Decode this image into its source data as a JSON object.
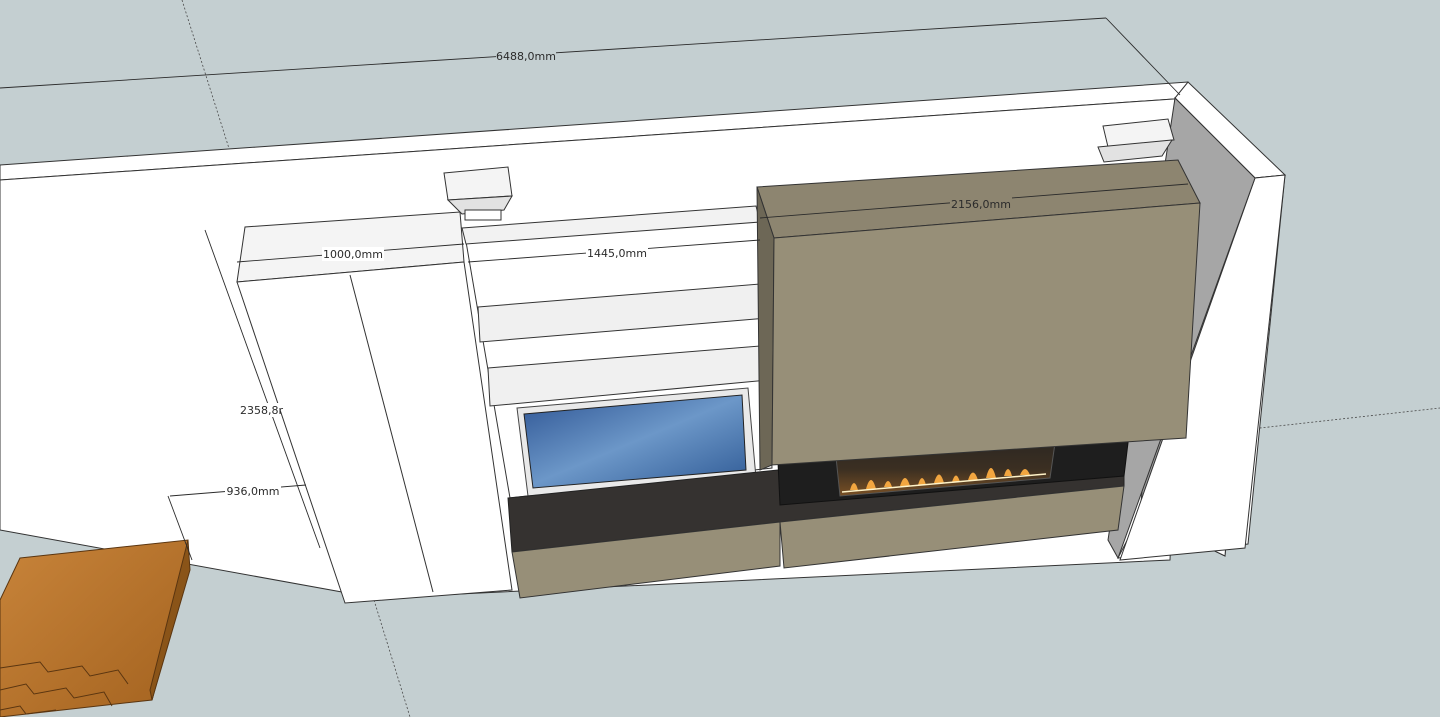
{
  "dimensions": {
    "overall_width": "6488,0mm",
    "left_shelf_depth": "1000,0mm",
    "tv_niche_width": "1445,0mm",
    "fireplace_block_width": "2156,0mm",
    "height": "2358,8r",
    "floor_offset": "936,0mm"
  },
  "colors": {
    "background": "#c4cfd1",
    "wall": "#ffffff",
    "wall_side": "#9a9a9a",
    "khaki_panel": "#978f78",
    "khaki_dark": "#8a8370",
    "bench_top": "#353230",
    "fire": "#f2a640",
    "tv_screen": "#4c79b0",
    "wood": "#b4722e"
  }
}
